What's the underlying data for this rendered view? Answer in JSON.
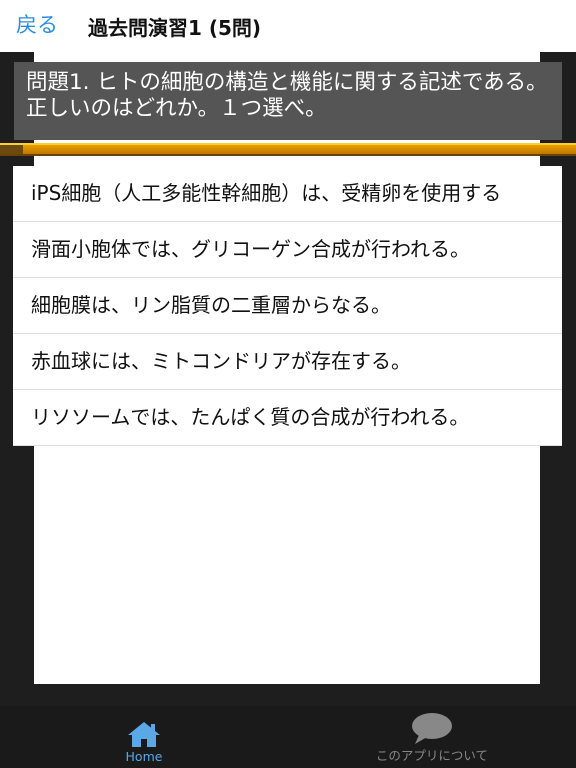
{
  "header": {
    "back_label": "戻る",
    "title": "過去問演習1 (5問)"
  },
  "question": {
    "text": "問題1. ヒトの細胞の構造と機能に関する記述である。正しいのはどれか。１つ選べ。"
  },
  "progress": {
    "value": 0.04
  },
  "options": [
    "iPS細胞（人工多能性幹細胞）は、受精卵を使用する",
    "滑面小胞体では、グリコーゲン合成が行われる。",
    "細胞膜は、リン脂質の二重層からなる。",
    "赤血球には、ミトコンドリアが存在する。",
    "リソソームでは、たんぱく質の合成が行われる。"
  ],
  "tabs": [
    {
      "label": "Home",
      "icon": "home-icon",
      "active": true
    },
    {
      "label": "このアプリについて",
      "icon": "chat-bubble-icon",
      "active": false
    }
  ],
  "colors": {
    "accent": "#2c8de0",
    "progress": "#e8a000",
    "tab_active": "#5aa9e6"
  }
}
